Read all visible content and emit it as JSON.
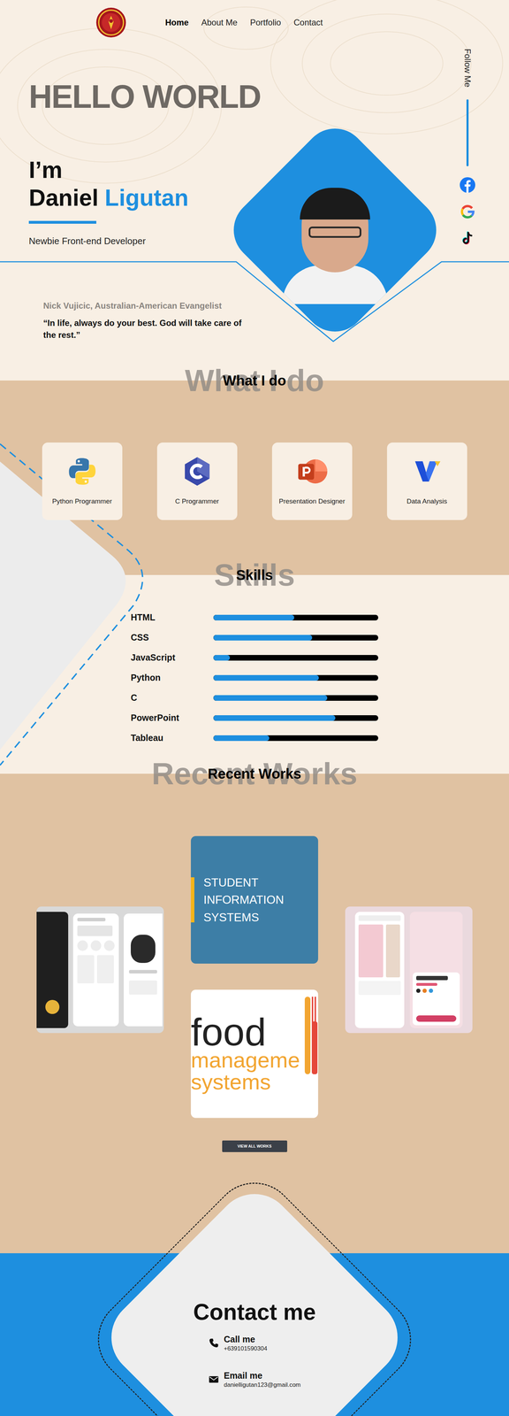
{
  "nav": {
    "links": [
      {
        "label": "Home",
        "selected": true
      },
      {
        "label": "About Me",
        "selected": false
      },
      {
        "label": "Portfolio",
        "selected": false
      },
      {
        "label": "Contact",
        "selected": false
      }
    ]
  },
  "social": {
    "label": "Follow Me",
    "links": [
      {
        "kind": "facebook"
      },
      {
        "kind": "google"
      },
      {
        "kind": "tiktok"
      }
    ]
  },
  "hero": {
    "greeting": "HELLO WORLD",
    "intro": "I’m",
    "first_name": "Daniel",
    "last_name": "Ligutan",
    "role": "Newbie Front-end Developer",
    "quote_author": "Nick Vujicic, Australian-American Evangelist",
    "quote": "“In life, always do your best. God will take care of the rest.”"
  },
  "services": {
    "watermark": "What I do",
    "title": "What I do",
    "items": [
      {
        "label": "Python Programmer",
        "kind": "python"
      },
      {
        "label": "C Programmer",
        "kind": "c"
      },
      {
        "label": "Presentation Designer",
        "kind": "powerpoint"
      },
      {
        "label": "Data Analysis",
        "kind": "analysis"
      }
    ]
  },
  "skills": {
    "watermark": "Skills",
    "title": "Skills",
    "items": [
      {
        "label": "HTML",
        "level": 0.49
      },
      {
        "label": "CSS",
        "level": 0.6
      },
      {
        "label": "JavaScript",
        "level": 0.1
      },
      {
        "label": "Python",
        "level": 0.64
      },
      {
        "label": "C",
        "level": 0.69
      },
      {
        "label": "PowerPoint",
        "level": 0.74
      },
      {
        "label": "Tableau",
        "level": 0.34
      }
    ]
  },
  "works": {
    "watermark": "Recent Works",
    "title": "Recent Works",
    "student_tile": "STUDENT INFORMATION SYSTEMS",
    "food_tile": [
      "food",
      "manageme",
      "systems"
    ],
    "button": "VIEW ALL WORKS"
  },
  "contact": {
    "title": "Contact me",
    "items": [
      {
        "kind": "phone",
        "label": "Call me",
        "value": "+639101590304"
      },
      {
        "kind": "email",
        "label": "Email me",
        "value": "danielligutan123@gmail.com"
      }
    ]
  }
}
